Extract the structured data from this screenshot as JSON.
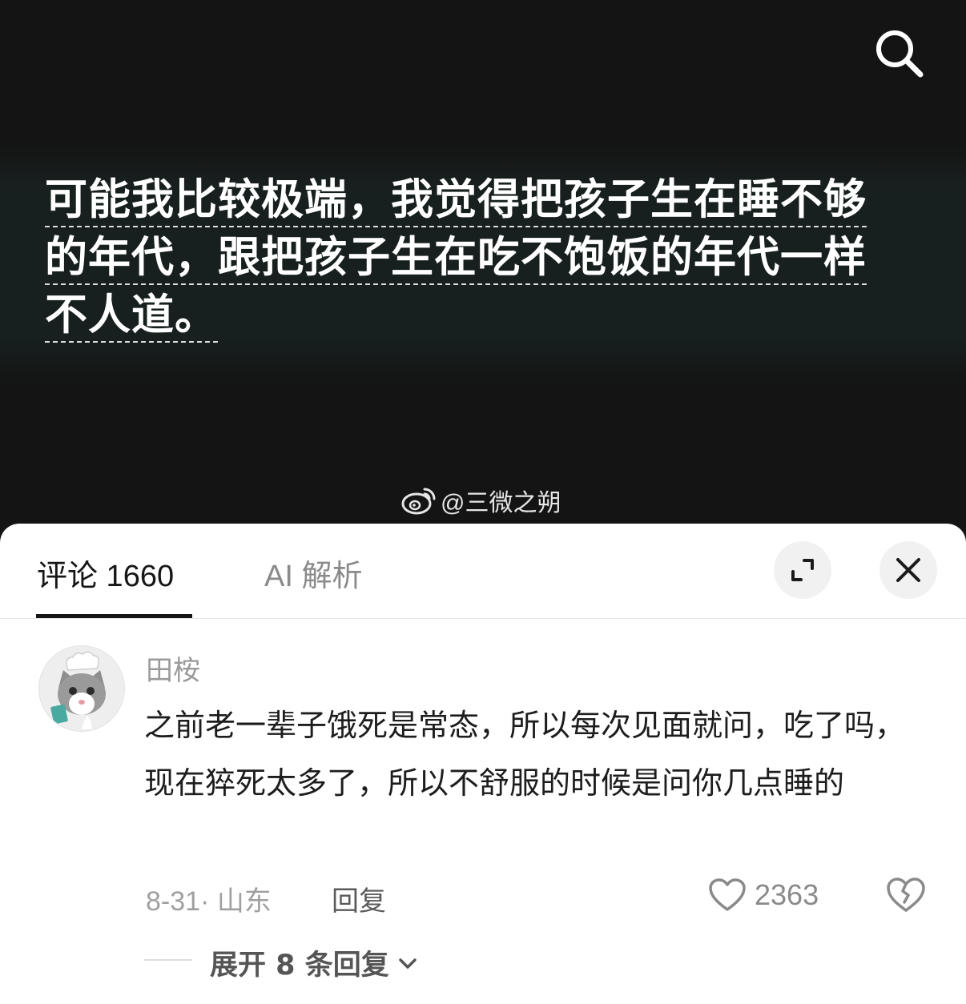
{
  "video": {
    "overlay_lines": [
      "可能我比较极端，我觉得把孩子生在睡不够",
      "的年代，跟把孩子生在吃不饱饭的年代一样",
      "不人道。"
    ],
    "watermark": "@三微之朔",
    "search_icon": "search-icon",
    "watermark_icon": "weibo-logo"
  },
  "tabs": {
    "comments_label": "评论 1660",
    "ai_label": "AI 解析"
  },
  "controls": {
    "expand_icon": "expand-icon",
    "close_icon": "close-icon"
  },
  "comment": {
    "username": "田桉",
    "avatar": "cat-chef-avatar",
    "text": "之前老一辈子饿死是常态，所以每次见面就问，吃了吗，现在猝死太多了，所以不舒服的时候是问你几点睡的",
    "meta": "8-31· 山东",
    "reply_label": "回复",
    "like_count": "2363",
    "like_icon": "heart-icon",
    "dislike_icon": "broken-heart-icon",
    "expand_replies_label": "展开 8 条回复"
  },
  "colors": {
    "video_bg": "#141414",
    "sheet_bg": "#ffffff",
    "primary_text": "#161616",
    "secondary_text": "#9a9a9a"
  }
}
